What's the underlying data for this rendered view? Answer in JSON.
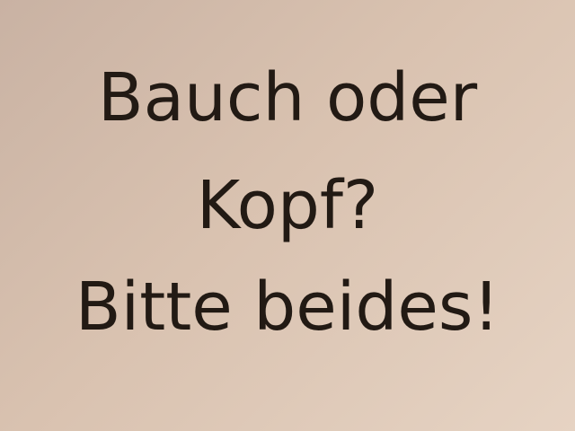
{
  "slide": {
    "lines": [
      "Bauch oder",
      "Kopf?",
      "Bitte beides!"
    ],
    "background_color": "#d9c2b0",
    "text_color": "#221a14"
  }
}
